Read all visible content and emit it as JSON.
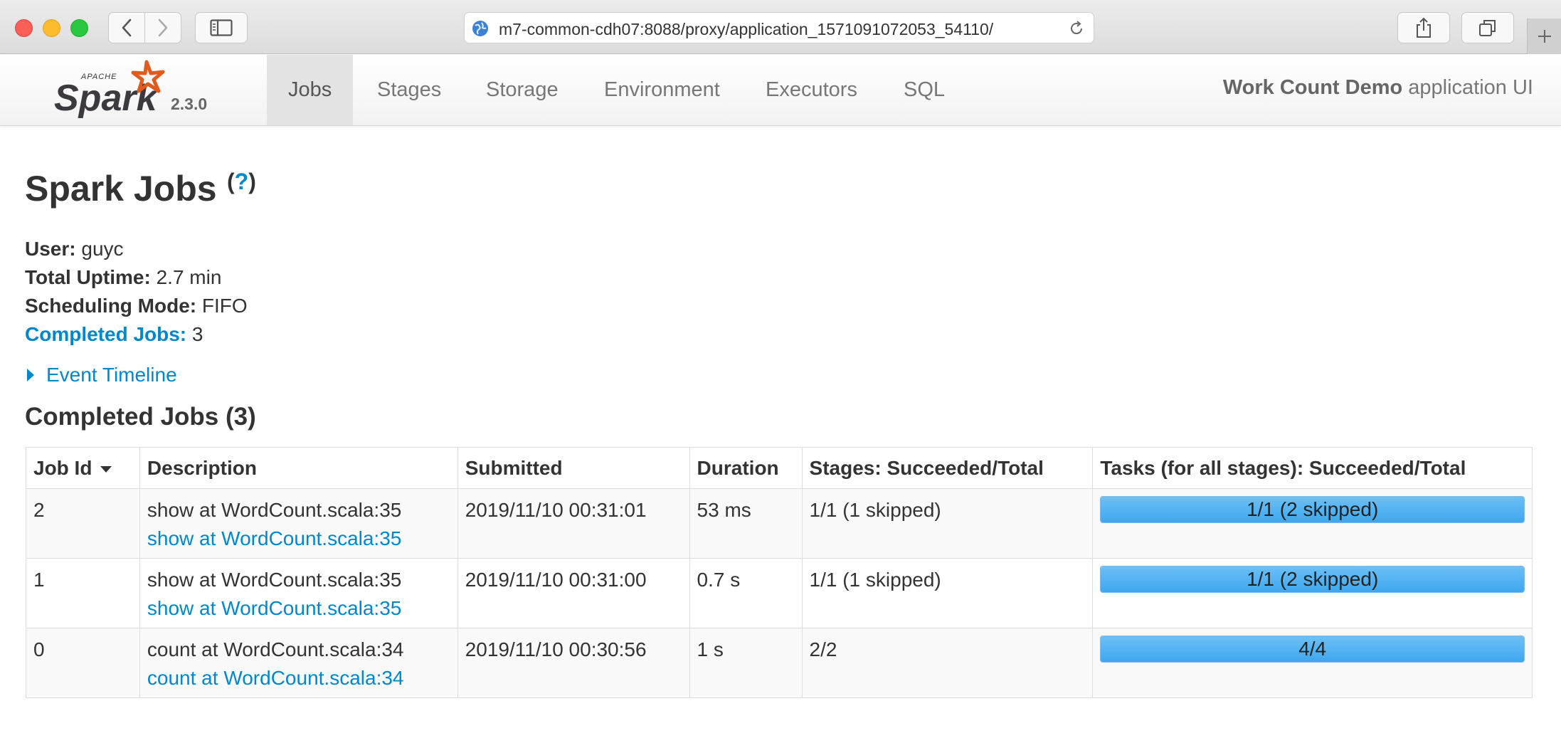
{
  "browser": {
    "url": "m7-common-cdh07:8088/proxy/application_1571091072053_54110/"
  },
  "spark_nav": {
    "version": "2.3.0",
    "tabs": [
      {
        "label": "Jobs",
        "active": true
      },
      {
        "label": "Stages",
        "active": false
      },
      {
        "label": "Storage",
        "active": false
      },
      {
        "label": "Environment",
        "active": false
      },
      {
        "label": "Executors",
        "active": false
      },
      {
        "label": "SQL",
        "active": false
      }
    ],
    "app_name": "Work Count Demo",
    "app_suffix": " application UI"
  },
  "page": {
    "title": "Spark Jobs",
    "help": "?",
    "user_label": "User:",
    "user": "guyc",
    "uptime_label": "Total Uptime:",
    "uptime": "2.7 min",
    "scheduling_label": "Scheduling Mode:",
    "scheduling": "FIFO",
    "completed_label": "Completed Jobs:",
    "completed": "3",
    "event_timeline": "Event Timeline",
    "section_title": "Completed Jobs (3)"
  },
  "table": {
    "headers": [
      "Job Id",
      "Description",
      "Submitted",
      "Duration",
      "Stages: Succeeded/Total",
      "Tasks (for all stages): Succeeded/Total"
    ],
    "rows": [
      {
        "id": "2",
        "desc": "show at WordCount.scala:35",
        "desc_link": "show at WordCount.scala:35",
        "submitted": "2019/11/10 00:31:01",
        "duration": "53 ms",
        "stages": "1/1 (1 skipped)",
        "tasks": "1/1 (2 skipped)",
        "tasks_progress": 1.0
      },
      {
        "id": "1",
        "desc": "show at WordCount.scala:35",
        "desc_link": "show at WordCount.scala:35",
        "submitted": "2019/11/10 00:31:00",
        "duration": "0.7 s",
        "stages": "1/1 (1 skipped)",
        "tasks": "1/1 (2 skipped)",
        "tasks_progress": 1.0
      },
      {
        "id": "0",
        "desc": "count at WordCount.scala:34",
        "desc_link": "count at WordCount.scala:34",
        "submitted": "2019/11/10 00:30:56",
        "duration": "1 s",
        "stages": "2/2",
        "tasks": "4/4",
        "tasks_progress": 1.0
      }
    ]
  },
  "colors": {
    "link": "#0088cc",
    "progress": "#3ea7ef"
  }
}
